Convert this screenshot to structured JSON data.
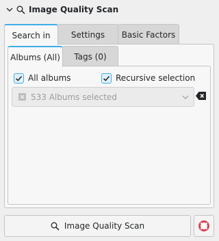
{
  "header": {
    "title": "Image Quality Scan",
    "icons": [
      "chevron-down-icon",
      "search-icon"
    ]
  },
  "tabs_outer": [
    {
      "label": "Search in",
      "active": true
    },
    {
      "label": "Settings",
      "active": false
    },
    {
      "label": "Basic Factors",
      "active": false
    }
  ],
  "tabs_inner": [
    {
      "label": "Albums (All)",
      "active": true
    },
    {
      "label": "Tags (0)",
      "active": false
    }
  ],
  "options": {
    "all_albums": {
      "label": "All albums",
      "checked": true
    },
    "recursive": {
      "label": "Recursive selection",
      "checked": true
    }
  },
  "album_combo": {
    "value": "533 Albums selected",
    "disabled": true
  },
  "actions": {
    "scan_label": "Image Quality Scan"
  },
  "colors": {
    "accent": "#3daee9",
    "help_icon": "#da4453",
    "background": "#efefef"
  }
}
